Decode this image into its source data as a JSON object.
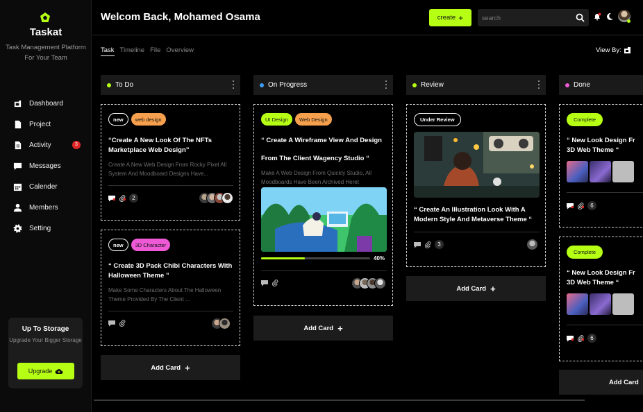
{
  "app": {
    "name": "Taskat",
    "tagline": "Task Management Platform For Your Team",
    "accent": "#b6ff14"
  },
  "sidebar": {
    "items": [
      {
        "label": "Dashboard",
        "icon": "dashboard-icon"
      },
      {
        "label": "Project",
        "icon": "file-icon"
      },
      {
        "label": "Activity",
        "icon": "activity-icon",
        "badge": "3"
      },
      {
        "label": "Messages",
        "icon": "message-icon"
      },
      {
        "label": "Calender",
        "icon": "calendar-icon"
      },
      {
        "label": "Members",
        "icon": "user-icon"
      },
      {
        "label": "Setting",
        "icon": "gear-icon"
      }
    ],
    "storage": {
      "title": "Up To Storage",
      "subtitle": "Upgrade Your Bigger Storage",
      "button": "Upgrade"
    }
  },
  "header": {
    "welcome": "Welcom Back, Mohamed Osama",
    "create_label": "create",
    "search_placeholder": "search"
  },
  "tabs": [
    "Task",
    "Timeline",
    "File",
    "Overview"
  ],
  "active_tab": "Task",
  "view_by_label": "View By:",
  "columns": [
    {
      "title": "To Do",
      "dot": "#b6ff14",
      "add_label": "Add Card",
      "cards": [
        {
          "tags": [
            {
              "label": "new",
              "style": "outline"
            },
            {
              "label": "web design",
              "color": "#f6a04d"
            }
          ],
          "title": "“Create A New Look Of The NFTs Marketplace Web Design”",
          "desc": "Create A New Web Design From Rocky Pixel All System And Moodboard Designs Have...",
          "count": "2"
        },
        {
          "tags": [
            {
              "label": "new",
              "style": "outline"
            },
            {
              "label": "3D Character",
              "color": "#ee5ad6"
            }
          ],
          "title": "“ Create 3D Pack Chibi Characters With Halloween Theme ”",
          "desc": "Make Some Characters About The Halloween Theme Provided By The Client ..."
        }
      ]
    },
    {
      "title": "On Progress",
      "dot": "#3a9ff5",
      "add_label": "Add Card",
      "cards": [
        {
          "tags": [
            {
              "label": "UI Design",
              "color": "#b6ff14"
            },
            {
              "label": "Web Design",
              "color": "#f6a04d"
            }
          ],
          "title1": "“ Create A Wireframe View And Design",
          "title2": "From The Client Wagency  Studio “",
          "desc": "Make A Web Design From Quickly Studio, All Moodboards Have Been Archived Heret",
          "progress": 0.4,
          "progress_label": "40%"
        }
      ]
    },
    {
      "title": "Review",
      "dot": "#b6ff14",
      "add_label": "Add Card",
      "cards": [
        {
          "tags": [
            {
              "label": "Under Review",
              "style": "outline"
            }
          ],
          "title": "“ Create An Illustration Look With A Modern Style And Metaverse Theme “",
          "count": "3"
        }
      ]
    },
    {
      "title": "Done",
      "dot": "#ee5ad6",
      "add_label": "Add Card",
      "cards": [
        {
          "tags": [
            {
              "label": "Complete",
              "color": "#b6ff14"
            }
          ],
          "title": "“ New Look Design Fr 3D Web Theme “",
          "count": "6"
        },
        {
          "tags": [
            {
              "label": "Complete",
              "color": "#b6ff14"
            }
          ],
          "title": "“ New Look Design Fr 3D Web Theme “",
          "count": "6"
        }
      ]
    }
  ]
}
